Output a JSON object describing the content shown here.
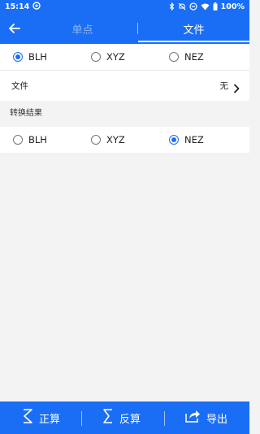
{
  "status": {
    "time": "15:14",
    "battery": "100%"
  },
  "nav": {
    "tabs": [
      {
        "label": "单点"
      },
      {
        "label": "文件"
      }
    ]
  },
  "source_coord": {
    "options": [
      {
        "label": "BLH"
      },
      {
        "label": "XYZ"
      },
      {
        "label": "NEZ"
      }
    ],
    "selected": "BLH"
  },
  "file": {
    "label": "文件",
    "value": "无"
  },
  "result": {
    "section_label": "转换结果",
    "options": [
      {
        "label": "BLH"
      },
      {
        "label": "XYZ"
      },
      {
        "label": "NEZ"
      }
    ],
    "selected": "NEZ"
  },
  "footer": {
    "buttons": [
      {
        "label": "正算"
      },
      {
        "label": "反算"
      },
      {
        "label": "导出"
      }
    ]
  },
  "colors": {
    "primary": "#1a6ef5",
    "background": "#f3f3f3",
    "inactive_tab": "#8fb5f7"
  }
}
